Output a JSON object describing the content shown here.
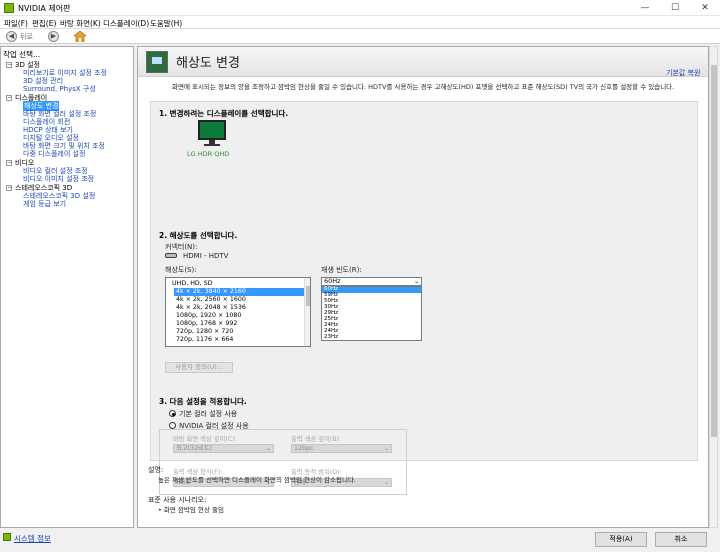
{
  "window": {
    "title": "NVIDIA 제어판",
    "min": "—",
    "max": "☐",
    "close": "✕"
  },
  "menu": [
    "파일(F)",
    "편집(E)",
    "바탕 화면(K)",
    "디스플레이(D)",
    "도움말(H)"
  ],
  "toolbar": {
    "back_label": "뒤로"
  },
  "left_pane": {
    "header": "작업 선택...",
    "tree": [
      {
        "type": "cat",
        "label": "3D 설정",
        "toggle": "−"
      },
      {
        "type": "child",
        "label": "미리보기로 이미지 설정 조정"
      },
      {
        "type": "child",
        "label": "3D 설정 관리"
      },
      {
        "type": "child",
        "label": "Surround, PhysX 구성"
      },
      {
        "type": "cat",
        "label": "디스플레이",
        "toggle": "−"
      },
      {
        "type": "child",
        "label": "해상도 변경",
        "selected": true
      },
      {
        "type": "child",
        "label": "바탕 화면 컬러 설정 조정"
      },
      {
        "type": "child",
        "label": "디스플레이 회전"
      },
      {
        "type": "child",
        "label": "HDCP 상태 보기"
      },
      {
        "type": "child",
        "label": "디지털 오디오 설정"
      },
      {
        "type": "child",
        "label": "바탕 화면 크기 및 위치 조정"
      },
      {
        "type": "child",
        "label": "다중 디스플레이 설정"
      },
      {
        "type": "cat",
        "label": "비디오",
        "toggle": "−"
      },
      {
        "type": "child",
        "label": "비디오 컬러 설정 조정"
      },
      {
        "type": "child",
        "label": "비디오 이미지 설정 조정"
      },
      {
        "type": "cat",
        "label": "스테레오스코픽 3D",
        "toggle": "−"
      },
      {
        "type": "child",
        "label": "스테레오스코픽 3D 설정"
      },
      {
        "type": "child",
        "label": "게임 등급 보기"
      }
    ],
    "system_info": "시스템 정보"
  },
  "main": {
    "title": "해상도 변경",
    "restore_defaults": "기본값 복원",
    "description": "화면에 표시되는 정보의 양을 조정하고 깜박임 현상을 줄일 수 있습니다. HDTV를 사용하는 경우 고해상도(HD) 포맷을 선택하고 표준 해상도(SD) TV의 국가 신호를 설정할 수 있습니다.",
    "section1": "1. 변경하려는 디스플레이를 선택합니다.",
    "display_name": "LG HDR QHD",
    "section2": "2. 해상도를 선택합니다.",
    "connector_label": "커넥터(N):",
    "connector_value": "HDMI - HDTV",
    "resolution_label": "해상도(S):",
    "resolution_category": "UHD, HD, SD",
    "resolutions": [
      "4k × 2k, 3840 × 2160",
      "4k × 2k, 2560 × 1600",
      "4k × 2k, 2048 × 1536",
      "1080p, 1920 × 1080",
      "1080p, 1768 × 992",
      "720p, 1280 × 720",
      "720p, 1176 × 664"
    ],
    "selected_resolution_index": 0,
    "refresh_label": "재생 빈도(R):",
    "refresh_value": "60Hz",
    "refresh_options": [
      "60Hz",
      "59Hz",
      "50Hz",
      "30Hz",
      "29Hz",
      "25Hz",
      "24Hz",
      "24Hz",
      "23Hz"
    ],
    "custom_button": "사용자 정의(U)...",
    "section3": "3. 다음 설정을 적용합니다.",
    "radio_default": "기본 컬러 설정 사용",
    "radio_nvidia": "NVIDIA 컬러 설정 사용",
    "desktop_color_depth_label": "바탕 화면 색상 깊이(C):",
    "desktop_color_depth_value": "최고(32비트)",
    "output_color_depth_label": "출력 색상 깊이(B):",
    "output_color_depth_value": "12bpc",
    "output_color_format_label": "출력 색상 형식(F):",
    "output_color_format_value": "RGB",
    "output_dynamic_range_label": "출력 동적 범위(O):",
    "output_dynamic_range_value": "전체",
    "explanation_label": "설명:",
    "explanation_text": "높은 재생 빈도를 선택하면 디스플레이 화면의 깜박임 현상이 감소됩니다.",
    "typical_label": "표준 사용 시나리오:",
    "typical_text": "• 화면 깜박임 현상 줄임"
  },
  "buttons": {
    "apply": "적용(A)",
    "cancel": "취소"
  },
  "colors": {
    "accent": "#3399ff",
    "nvidia_green": "#76b900",
    "link": "#1a47b8"
  }
}
